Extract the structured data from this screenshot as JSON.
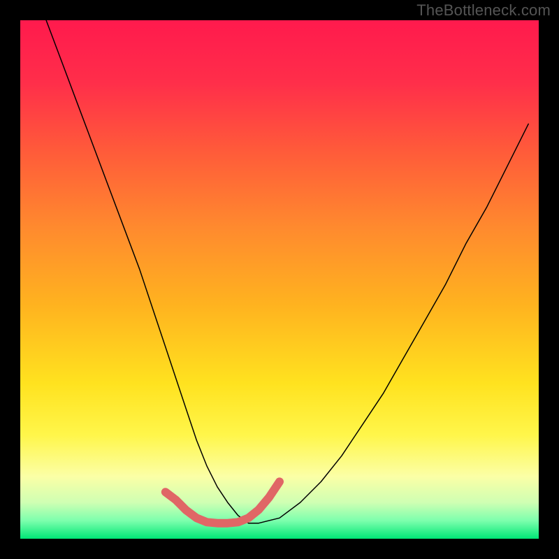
{
  "watermark": "TheBottleneck.com",
  "colors": {
    "page_bg": "#000000",
    "gradient_stops": [
      {
        "offset": 0.0,
        "color": "#ff1a4d"
      },
      {
        "offset": 0.12,
        "color": "#ff2e4a"
      },
      {
        "offset": 0.25,
        "color": "#ff5a3a"
      },
      {
        "offset": 0.4,
        "color": "#ff8a2e"
      },
      {
        "offset": 0.55,
        "color": "#ffb31f"
      },
      {
        "offset": 0.7,
        "color": "#ffe21f"
      },
      {
        "offset": 0.8,
        "color": "#fff64a"
      },
      {
        "offset": 0.88,
        "color": "#fbffa6"
      },
      {
        "offset": 0.93,
        "color": "#cfffb3"
      },
      {
        "offset": 0.965,
        "color": "#7dffad"
      },
      {
        "offset": 1.0,
        "color": "#00e676"
      }
    ],
    "curve": "#000000",
    "highlight": "#e06666"
  },
  "chart_data": {
    "type": "line",
    "title": "",
    "xlabel": "",
    "ylabel": "",
    "xlim": [
      0,
      100
    ],
    "ylim": [
      0,
      100
    ],
    "grid": false,
    "legend": false,
    "series": [
      {
        "name": "bottleneck-curve",
        "x": [
          5,
          8,
          11,
          14,
          17,
          20,
          23,
          26,
          28,
          30,
          32,
          34,
          36,
          38,
          40,
          42,
          44,
          46,
          50,
          54,
          58,
          62,
          66,
          70,
          74,
          78,
          82,
          86,
          90,
          94,
          98
        ],
        "y": [
          100,
          92,
          84,
          76,
          68,
          60,
          52,
          43,
          37,
          31,
          25,
          19,
          14,
          10,
          7,
          4.5,
          3,
          3,
          4,
          7,
          11,
          16,
          22,
          28,
          35,
          42,
          49,
          57,
          64,
          72,
          80
        ]
      },
      {
        "name": "highlighted-optimum",
        "x": [
          28,
          30,
          32,
          34,
          36,
          38,
          40,
          42,
          44,
          46,
          48,
          50
        ],
        "y": [
          9,
          7.5,
          5.5,
          4,
          3.2,
          3,
          3,
          3.2,
          4,
          5.6,
          8,
          11
        ]
      }
    ],
    "annotations": []
  }
}
